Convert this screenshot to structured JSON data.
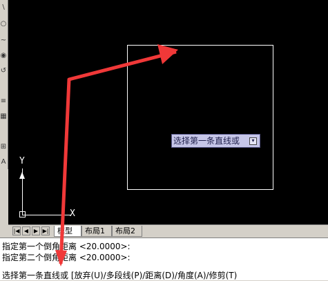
{
  "toolbar": {
    "buttons": [
      "\\",
      "○",
      "~",
      "◉",
      "↺",
      "≡",
      "▦",
      "⊞",
      "A"
    ]
  },
  "canvas": {
    "ucs": {
      "y_label": "Y",
      "x_label": "X"
    },
    "tooltip": {
      "text": "选择第一条直线或",
      "icon": "dropdown-icon"
    }
  },
  "tabs": {
    "nav": [
      "|◀",
      "◀",
      "▶",
      "▶|"
    ],
    "items": [
      {
        "label": "模型",
        "active": true
      },
      {
        "label": "布局1",
        "active": false
      },
      {
        "label": "布局2",
        "active": false
      }
    ]
  },
  "command": {
    "line1": "指定第一个倒角距离 <20.0000>:",
    "line2": "指定第二个倒角距离 <20.0000>:",
    "line3": "选择第一条直线或 [放弃(U)/多段线(P)/距离(D)/角度(A)/修剪(T)"
  },
  "colors": {
    "canvas": "#000000",
    "annotation_arrow": "#f03838",
    "tooltip_bg": "#c6c6e8"
  }
}
